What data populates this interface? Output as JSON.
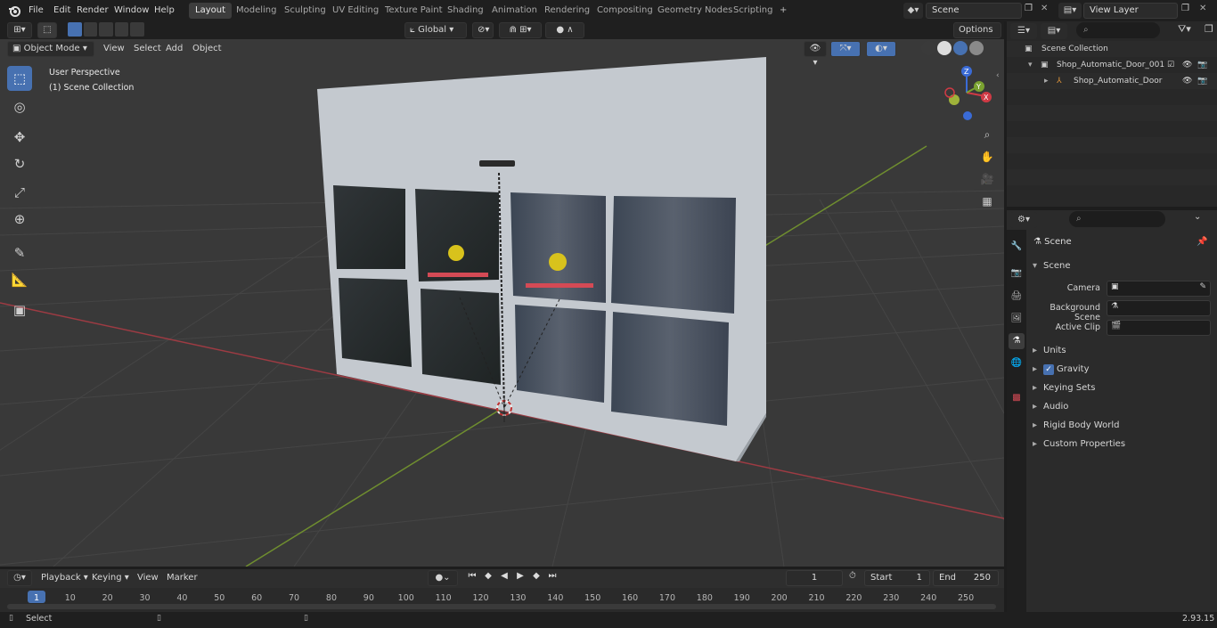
{
  "menu": {
    "file": "File",
    "edit": "Edit",
    "render": "Render",
    "window": "Window",
    "help": "Help"
  },
  "workspaces": [
    "Layout",
    "Modeling",
    "Sculpting",
    "UV Editing",
    "Texture Paint",
    "Shading",
    "Animation",
    "Rendering",
    "Compositing",
    "Geometry Nodes",
    "Scripting"
  ],
  "active_workspace": "Layout",
  "scene_field": "Scene",
  "view_layer_field": "View Layer",
  "viewport": {
    "mode": "Object Mode",
    "menus": [
      "View",
      "Select",
      "Add",
      "Object"
    ],
    "orientation": "Global",
    "options": "Options",
    "overlay_line1": "User Perspective",
    "overlay_line2": "(1) Scene Collection",
    "gizmo_axes": {
      "x": "X",
      "y": "Y",
      "z": "Z"
    },
    "colors": {
      "x_axis": "#9d3b43",
      "y_axis": "#6f8e2f",
      "active_tool": "#4771b1"
    }
  },
  "outliner": {
    "root": "Scene Collection",
    "items": [
      {
        "label": "Shop_Automatic_Door_001"
      },
      {
        "label": "Shop_Automatic_Door"
      }
    ]
  },
  "properties": {
    "header": "Scene",
    "section": "Scene",
    "fields": [
      {
        "label": "Camera",
        "value": ""
      },
      {
        "label": "Background Scene",
        "value": ""
      },
      {
        "label": "Active Clip",
        "value": ""
      }
    ],
    "panels": [
      "Units",
      "Gravity",
      "Keying Sets",
      "Audio",
      "Rigid Body World",
      "Custom Properties"
    ],
    "gravity_checked": true
  },
  "timeline": {
    "menus": [
      "Playback",
      "Keying",
      "View",
      "Marker"
    ],
    "current_frame": "1",
    "start_label": "Start",
    "start": "1",
    "end_label": "End",
    "end": "250",
    "ticks": [
      "1",
      "10",
      "20",
      "30",
      "40",
      "50",
      "60",
      "70",
      "80",
      "90",
      "100",
      "110",
      "120",
      "130",
      "140",
      "150",
      "160",
      "170",
      "180",
      "190",
      "200",
      "210",
      "220",
      "230",
      "240",
      "250"
    ]
  },
  "status": {
    "left": "Select",
    "version": "2.93.15"
  }
}
